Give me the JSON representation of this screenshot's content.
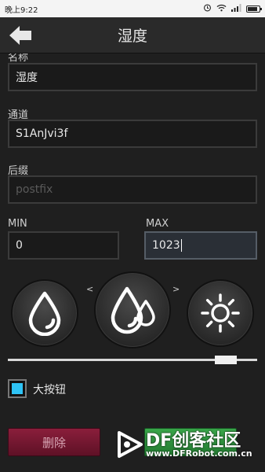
{
  "status_bar": {
    "time": "晚上9:22",
    "icons": [
      "alarm-icon",
      "wifi-icon",
      "signal-icon",
      "battery-icon"
    ]
  },
  "header": {
    "title": "湿度",
    "back_icon": "back-arrow-icon"
  },
  "form": {
    "name": {
      "label": "名称",
      "value": "湿度"
    },
    "channel": {
      "label": "通道",
      "value": "S1AnJvi3f"
    },
    "suffix": {
      "label": "后缀",
      "placeholder": "postfix"
    },
    "min": {
      "label": "MIN",
      "value": "0"
    },
    "max": {
      "label": "MAX",
      "value": "1023"
    }
  },
  "icon_selector": {
    "prev_label": "<",
    "next_label": ">",
    "icons": [
      "single-drop-icon",
      "double-drop-icon",
      "sun-icon"
    ],
    "selected": "double-drop-icon"
  },
  "slider": {
    "value": 0.9
  },
  "big_button": {
    "label": "大按钮",
    "checked": true
  },
  "actions": {
    "delete_label": "删除"
  },
  "watermark": {
    "text": "DF创客社区",
    "url": "www.DFRobot.com.cn"
  },
  "colors": {
    "checkbox_fill": "#2ec3f5",
    "delete_button": "#7a1a34",
    "confirm_button": "#2f9a40"
  }
}
